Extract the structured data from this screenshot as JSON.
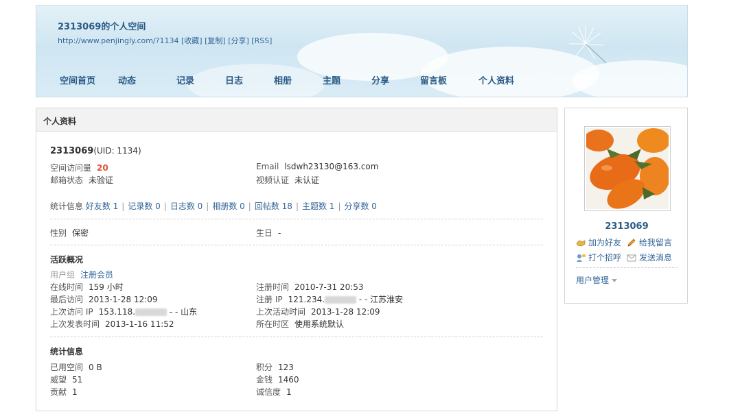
{
  "header": {
    "title": "2313069的个人空间",
    "url": "http://www.penjingly.com/?1134",
    "links": [
      "[收藏]",
      "[复制]",
      "[分享]",
      "[RSS]"
    ],
    "nav": [
      "空间首页",
      "动态",
      "记录",
      "日志",
      "相册",
      "主题",
      "分享",
      "留言板",
      "个人资料"
    ]
  },
  "panel": {
    "title": "个人资料",
    "username": "2313069",
    "uid": "(UID: 1134)",
    "visits_label": "空间访问量",
    "visits": "20",
    "email_label": "Email",
    "email": "lsdwh23130@163.com",
    "email_status_label": "邮箱状态",
    "email_status": "未验证",
    "video_label": "视频认证",
    "video_status": "未认证",
    "stats_label": "统计信息",
    "stats": [
      "好友数 1",
      "记录数 0",
      "日志数 0",
      "相册数 0",
      "回帖数 18",
      "主题数 1",
      "分享数 0"
    ],
    "gender_label": "性别",
    "gender": "保密",
    "birthday_label": "生日",
    "birthday": "-",
    "activity_title": "活跃概况",
    "group_label": "用户组",
    "group": "注册会员",
    "online_label": "在线时间",
    "online": "159 小时",
    "reg_time_label": "注册时间",
    "reg_time": "2010-7-31 20:53",
    "last_visit_label": "最后访问",
    "last_visit": "2013-1-28 12:09",
    "reg_ip_label": "注册 IP",
    "reg_ip_prefix": "121.234.",
    "reg_ip_suffix": "- - 江苏淮安",
    "last_ip_label": "上次访问 IP",
    "last_ip_prefix": "153.118.",
    "last_ip_suffix": "- - 山东",
    "last_active_label": "上次活动时间",
    "last_active": "2013-1-28 12:09",
    "last_post_label": "上次发表时间",
    "last_post": "2013-1-16 11:52",
    "tz_label": "所在时区",
    "tz": "使用系统默认",
    "stat_title": "统计信息",
    "space_label": "已用空间",
    "space": "0 B",
    "points_label": "积分",
    "points": "123",
    "prestige_label": "威望",
    "prestige": "51",
    "money_label": "金钱",
    "money": "1460",
    "contrib_label": "贡献",
    "contrib": "1",
    "credit_label": "诚信度",
    "credit": "1"
  },
  "sidebar": {
    "name": "2313069",
    "add_friend": "加为好友",
    "leave_msg": "给我留言",
    "greet": "打个招呼",
    "send_msg": "发送消息",
    "user_mgmt": "用户管理"
  }
}
